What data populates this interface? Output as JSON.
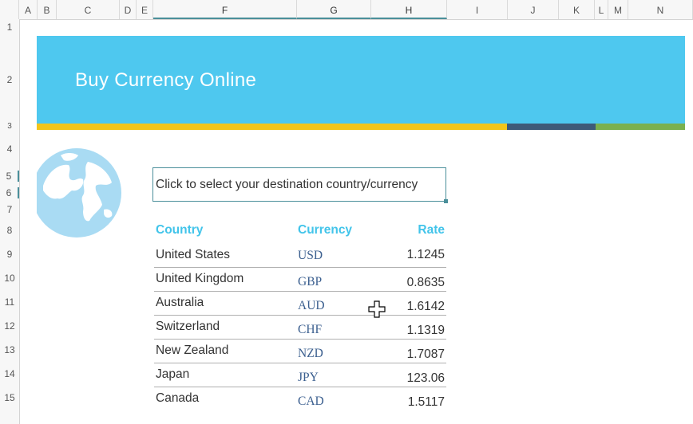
{
  "columns": [
    "A",
    "B",
    "C",
    "D",
    "E",
    "F",
    "G",
    "H",
    "I",
    "J",
    "K",
    "L",
    "M",
    "N"
  ],
  "rows": [
    "1",
    "2",
    "3",
    "4",
    "5",
    "6",
    "7",
    "8",
    "9",
    "10",
    "11",
    "12",
    "13",
    "14",
    "15"
  ],
  "banner": {
    "title": "Buy Currency Online",
    "bg_color": "#4ec8ef"
  },
  "stripes": {
    "colors": [
      "#f2c51b",
      "#3e5a78",
      "#7ab04f"
    ]
  },
  "selector": {
    "text": "Click to select your destination country/currency"
  },
  "table": {
    "headers": {
      "country": "Country",
      "currency": "Currency",
      "rate": "Rate"
    },
    "rows": [
      {
        "country": "United States",
        "currency": "USD",
        "rate": "1.1245"
      },
      {
        "country": "United Kingdom",
        "currency": "GBP",
        "rate": "0.8635"
      },
      {
        "country": "Australia",
        "currency": "AUD",
        "rate": "1.6142"
      },
      {
        "country": "Switzerland",
        "currency": "CHF",
        "rate": "1.1319"
      },
      {
        "country": "New Zealand",
        "currency": "NZD",
        "rate": "1.7087"
      },
      {
        "country": "Japan",
        "currency": "JPY",
        "rate": "123.06"
      },
      {
        "country": "Canada",
        "currency": "CAD",
        "rate": "1.5117"
      }
    ]
  },
  "colors": {
    "header_text": "#42c4ea",
    "currency_text": "#3b5f8f",
    "selection": "#4a8f9a"
  },
  "icons": {
    "globe": "globe-icon",
    "cursor": "move-cursor-icon"
  }
}
